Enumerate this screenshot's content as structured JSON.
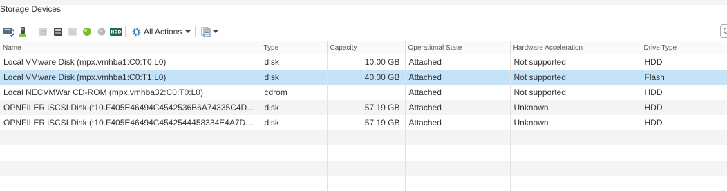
{
  "panel": {
    "title": "Storage Devices"
  },
  "toolbar": {
    "icons": [
      "rescan-storage-icon",
      "attach-disk-icon",
      "detach-disk-icon",
      "storage-device-icon",
      "cpu-chip-icon",
      "turn-on-led-icon",
      "turn-off-led-icon",
      "hdd-tag-icon"
    ],
    "hdd_label": "HDD",
    "all_actions_label": "All Actions",
    "accent": "#3a7fc1"
  },
  "table": {
    "columns": [
      "Name",
      "Type",
      "Capacity",
      "Operational State",
      "Hardware Acceleration",
      "Drive Type"
    ],
    "rows": [
      {
        "name": "Local VMware Disk (mpx.vmhba1:C0:T0:L0)",
        "type": "disk",
        "capacity": "10.00 GB",
        "state": "Attached",
        "hw_accel": "Not supported",
        "drive_type": "HDD"
      },
      {
        "name": "Local VMware Disk (mpx.vmhba1:C0:T1:L0)",
        "type": "disk",
        "capacity": "40.00 GB",
        "state": "Attached",
        "hw_accel": "Not supported",
        "drive_type": "Flash"
      },
      {
        "name": "Local NECVMWar CD-ROM (mpx.vmhba32:C0:T0:L0)",
        "type": "cdrom",
        "capacity": "",
        "state": "Attached",
        "hw_accel": "Not supported",
        "drive_type": "HDD"
      },
      {
        "name": "OPNFILER iSCSI Disk (t10.F405E46494C4542536B6A74335C4D...",
        "type": "disk",
        "capacity": "57.19 GB",
        "state": "Attached",
        "hw_accel": "Unknown",
        "drive_type": "HDD"
      },
      {
        "name": "OPNFILER iSCSI Disk (t10.F405E46494C4542544458334E4A7D...",
        "type": "disk",
        "capacity": "57.19 GB",
        "state": "Attached",
        "hw_accel": "Unknown",
        "drive_type": "HDD"
      }
    ],
    "selected_row": 1
  }
}
